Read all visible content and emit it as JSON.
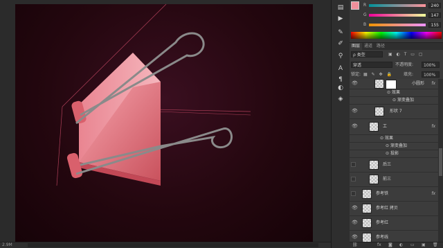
{
  "status": {
    "zoom": "2.9M"
  },
  "color_panel": {
    "fg_color": "#f08f9b",
    "bg_color": "#ffffff",
    "channels": [
      {
        "label": "R",
        "value": "240"
      },
      {
        "label": "G",
        "value": "147"
      },
      {
        "label": "B",
        "value": "155"
      }
    ]
  },
  "tabs": [
    "图层",
    "通道",
    "路径"
  ],
  "filter": {
    "kind": "ρ 类型"
  },
  "blend": {
    "mode": "穿透",
    "opacity_label": "不透明度:",
    "opacity_value": "100%"
  },
  "lock": {
    "label": "锁定:",
    "fill_label": "填充:",
    "fill_value": "100%"
  },
  "layers": [
    {
      "name": "小圆形",
      "fx": "fx"
    },
    {
      "name": "效果"
    },
    {
      "name": "渐变叠加"
    },
    {
      "name": "形状 7"
    },
    {
      "name": "工",
      "fx": "fx"
    },
    {
      "name": "效果"
    },
    {
      "name": "渐变叠加"
    },
    {
      "name": "投影"
    },
    {
      "name": "后三"
    },
    {
      "name": "前三"
    },
    {
      "name": "参考铁",
      "fx": "fx"
    },
    {
      "name": "参考红 拷贝"
    },
    {
      "name": "参考红"
    },
    {
      "name": "参考线"
    }
  ],
  "colors": {
    "accent": "#f08f9b",
    "canvas_bg": "#24070f",
    "panel_bg": "#3a3a3a"
  }
}
